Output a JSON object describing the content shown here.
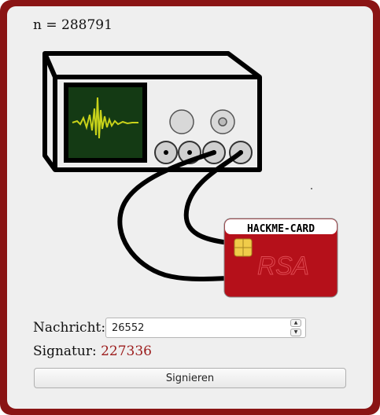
{
  "header": {
    "modulus_text": "n = 288791"
  },
  "card": {
    "title": "HACKME-CARD",
    "watermark": "RSA"
  },
  "form": {
    "message_label": "Nachricht:",
    "message_value": "26552",
    "signature_label": "Signatur:",
    "signature_value": "227336",
    "sign_button": "Signieren"
  },
  "colors": {
    "frame": "#8a1414",
    "card_red": "#b5101a",
    "signature_value": "#9c1c1c",
    "scope_trace": "#c8d21a"
  },
  "icons": [
    "oscilloscope",
    "smart-card",
    "chip-icon"
  ]
}
